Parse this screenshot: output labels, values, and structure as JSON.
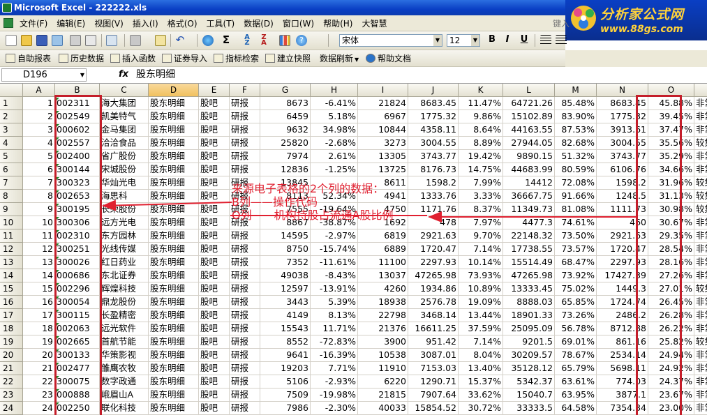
{
  "window": {
    "title": "Microsoft Excel - 222222.xls"
  },
  "brand": {
    "line1": "分析家公式网",
    "line2": "www.88gs.com"
  },
  "menu": {
    "items": [
      "文件(F)",
      "编辑(E)",
      "视图(V)",
      "插入(I)",
      "格式(O)",
      "工具(T)",
      "数据(D)",
      "窗口(W)",
      "帮助(H)",
      "大智慧"
    ],
    "help_box": "键入"
  },
  "toolbar": {
    "font_name": "宋体",
    "font_size": "12",
    "bold": "B",
    "italic": "I",
    "underline": "U"
  },
  "toolbar2": {
    "items": [
      "自助报表",
      "历史数据",
      "插入函数",
      "证券导入",
      "指标检索",
      "建立快照",
      "数据刷新",
      "帮助文档"
    ]
  },
  "formula": {
    "name_box": "D196",
    "fx": "fx",
    "content": "股东明细"
  },
  "columns": [
    "A",
    "B",
    "C",
    "D",
    "E",
    "F",
    "G",
    "H",
    "I",
    "J",
    "K",
    "L",
    "M",
    "N",
    "O",
    ""
  ],
  "rows": [
    {
      "n": "1",
      "a": "1",
      "b": "002311",
      "c": "海大集团",
      "d": "股东明细",
      "e": "股吧",
      "f": "研报",
      "g": "8673",
      "h": "-6.41%",
      "i": "21824",
      "j": "8683.45",
      "k": "11.47%",
      "l": "64721.26",
      "m": "85.48%",
      "nv": "8683.45",
      "o": "45.88%",
      "p": "非常"
    },
    {
      "n": "2",
      "a": "2",
      "b": "002549",
      "c": "凯美特气",
      "d": "股东明细",
      "e": "股吧",
      "f": "研报",
      "g": "6459",
      "h": "5.18%",
      "i": "6967",
      "j": "1775.32",
      "k": "9.86%",
      "l": "15102.89",
      "m": "83.90%",
      "nv": "1775.32",
      "o": "39.45%",
      "p": "非常"
    },
    {
      "n": "3",
      "a": "3",
      "b": "000602",
      "c": "金马集团",
      "d": "股东明细",
      "e": "股吧",
      "f": "研报",
      "g": "9632",
      "h": "34.98%",
      "i": "10844",
      "j": "4358.11",
      "k": "8.64%",
      "l": "44163.55",
      "m": "87.53%",
      "nv": "3913.61",
      "o": "37.47%",
      "p": "非常"
    },
    {
      "n": "4",
      "a": "4",
      "b": "002557",
      "c": "洽洽食品",
      "d": "股东明细",
      "e": "股吧",
      "f": "研报",
      "g": "25820",
      "h": "-2.68%",
      "i": "3273",
      "j": "3004.55",
      "k": "8.89%",
      "l": "27944.05",
      "m": "82.68%",
      "nv": "3004.55",
      "o": "35.56%",
      "p": "较集"
    },
    {
      "n": "5",
      "a": "5",
      "b": "002400",
      "c": "省广股份",
      "d": "股东明细",
      "e": "股吧",
      "f": "研报",
      "g": "7974",
      "h": "2.61%",
      "i": "13305",
      "j": "3743.77",
      "k": "19.42%",
      "l": "9890.15",
      "m": "51.32%",
      "nv": "3743.77",
      "o": "35.29%",
      "p": "非常"
    },
    {
      "n": "6",
      "a": "6",
      "b": "300144",
      "c": "宋城股份",
      "d": "股东明细",
      "e": "股吧",
      "f": "研报",
      "g": "12836",
      "h": "-1.25%",
      "i": "13725",
      "j": "8176.73",
      "k": "14.75%",
      "l": "44683.99",
      "m": "80.59%",
      "nv": "6106.76",
      "o": "34.66%",
      "p": "非常"
    },
    {
      "n": "7",
      "a": "7",
      "b": "300323",
      "c": "华灿光电",
      "d": "股东明细",
      "e": "股吧",
      "f": "研报",
      "g": "13845",
      "h": "",
      "i": "8611",
      "j": "1598.2",
      "k": "7.99%",
      "l": "14412",
      "m": "72.08%",
      "nv": "1598.2",
      "o": "31.96%",
      "p": "较集"
    },
    {
      "n": "8",
      "a": "8",
      "b": "002653",
      "c": "海思科",
      "d": "股东明细",
      "e": "股吧",
      "f": "研报",
      "g": "8113",
      "h": "52.34%",
      "i": "4941",
      "j": "1333.76",
      "k": "3.33%",
      "l": "36667.75",
      "m": "91.66%",
      "nv": "1248.5",
      "o": "31.13%",
      "p": "较集"
    },
    {
      "n": "9",
      "a": "9",
      "b": "300195",
      "c": "长荣股份",
      "d": "股东明细",
      "e": "股吧",
      "f": "研报",
      "g": "7555",
      "h": "-19.64%",
      "i": "4750",
      "j": "1171.76",
      "k": "8.37%",
      "l": "11349.73",
      "m": "81.08%",
      "nv": "1111.73",
      "o": "30.98%",
      "p": "较集"
    },
    {
      "n": "10",
      "a": "10",
      "b": "300306",
      "c": "远方光电",
      "d": "股东明细",
      "e": "股吧",
      "f": "研报",
      "g": "8867",
      "h": "-38.87%",
      "i": "1692",
      "j": "478",
      "k": "7.97%",
      "l": "4477.3",
      "m": "74.61%",
      "nv": "460",
      "o": "30.67%",
      "p": "非常"
    },
    {
      "n": "11",
      "a": "11",
      "b": "002310",
      "c": "东方园林",
      "d": "股东明细",
      "e": "股吧",
      "f": "研报",
      "g": "14595",
      "h": "-2.97%",
      "i": "6819",
      "j": "2921.63",
      "k": "9.70%",
      "l": "22148.32",
      "m": "73.50%",
      "nv": "2921.63",
      "o": "29.35%",
      "p": "非常"
    },
    {
      "n": "12",
      "a": "12",
      "b": "300251",
      "c": "光线传媒",
      "d": "股东明细",
      "e": "股吧",
      "f": "研报",
      "g": "8750",
      "h": "-15.74%",
      "i": "6889",
      "j": "1720.47",
      "k": "7.14%",
      "l": "17738.55",
      "m": "73.57%",
      "nv": "1720.47",
      "o": "28.54%",
      "p": "非常"
    },
    {
      "n": "13",
      "a": "13",
      "b": "300026",
      "c": "红日药业",
      "d": "股东明细",
      "e": "股吧",
      "f": "研报",
      "g": "7352",
      "h": "-11.61%",
      "i": "11100",
      "j": "2297.93",
      "k": "10.14%",
      "l": "15514.49",
      "m": "68.47%",
      "nv": "2297.93",
      "o": "28.16%",
      "p": "非常"
    },
    {
      "n": "14",
      "a": "14",
      "b": "000686",
      "c": "东北证券",
      "d": "股东明细",
      "e": "股吧",
      "f": "研报",
      "g": "49038",
      "h": "-8.43%",
      "i": "13037",
      "j": "47265.98",
      "k": "73.93%",
      "l": "47265.98",
      "m": "73.92%",
      "nv": "17427.39",
      "o": "27.26%",
      "p": "非常"
    },
    {
      "n": "15",
      "a": "15",
      "b": "002296",
      "c": "辉煌科技",
      "d": "股东明细",
      "e": "股吧",
      "f": "研报",
      "g": "12597",
      "h": "-13.91%",
      "i": "4260",
      "j": "1934.86",
      "k": "10.89%",
      "l": "13333.45",
      "m": "75.02%",
      "nv": "1449.3",
      "o": "27.01%",
      "p": "较集"
    },
    {
      "n": "16",
      "a": "16",
      "b": "300054",
      "c": "鼎龙股份",
      "d": "股东明细",
      "e": "股吧",
      "f": "研报",
      "g": "3443",
      "h": "5.39%",
      "i": "18938",
      "j": "2576.78",
      "k": "19.09%",
      "l": "8888.03",
      "m": "65.85%",
      "nv": "1724.74",
      "o": "26.45%",
      "p": "非常"
    },
    {
      "n": "17",
      "a": "17",
      "b": "300115",
      "c": "长盈精密",
      "d": "股东明细",
      "e": "股吧",
      "f": "研报",
      "g": "4149",
      "h": "8.13%",
      "i": "22798",
      "j": "3468.14",
      "k": "13.44%",
      "l": "18901.33",
      "m": "73.26%",
      "nv": "2486.2",
      "o": "26.28%",
      "p": "非常"
    },
    {
      "n": "18",
      "a": "18",
      "b": "002063",
      "c": "远光软件",
      "d": "股东明细",
      "e": "股吧",
      "f": "研报",
      "g": "15543",
      "h": "11.71%",
      "i": "21376",
      "j": "16611.25",
      "k": "37.59%",
      "l": "25095.09",
      "m": "56.78%",
      "nv": "8712.88",
      "o": "26.22%",
      "p": "非常"
    },
    {
      "n": "19",
      "a": "19",
      "b": "002665",
      "c": "首航节能",
      "d": "股东明细",
      "e": "股吧",
      "f": "研报",
      "g": "8552",
      "h": "-72.83%",
      "i": "3900",
      "j": "951.42",
      "k": "7.14%",
      "l": "9201.5",
      "m": "69.01%",
      "nv": "861.16",
      "o": "25.82%",
      "p": "较集"
    },
    {
      "n": "20",
      "a": "20",
      "b": "300133",
      "c": "华策影视",
      "d": "股东明细",
      "e": "股吧",
      "f": "研报",
      "g": "9641",
      "h": "-16.39%",
      "i": "10538",
      "j": "3087.01",
      "k": "8.04%",
      "l": "30209.57",
      "m": "78.67%",
      "nv": "2534.14",
      "o": "24.94%",
      "p": "非常"
    },
    {
      "n": "21",
      "a": "21",
      "b": "002477",
      "c": "雏鹰农牧",
      "d": "股东明细",
      "e": "股吧",
      "f": "研报",
      "g": "19203",
      "h": "7.71%",
      "i": "11910",
      "j": "7153.03",
      "k": "13.40%",
      "l": "35128.12",
      "m": "65.79%",
      "nv": "5698.11",
      "o": "24.92%",
      "p": "非常"
    },
    {
      "n": "22",
      "a": "22",
      "b": "300075",
      "c": "数字政通",
      "d": "股东明细",
      "e": "股吧",
      "f": "研报",
      "g": "5106",
      "h": "-2.93%",
      "i": "6220",
      "j": "1290.71",
      "k": "15.37%",
      "l": "5342.37",
      "m": "63.61%",
      "nv": "774.03",
      "o": "24.37%",
      "p": "非常"
    },
    {
      "n": "23",
      "a": "23",
      "b": "000888",
      "c": "峨眉山A",
      "d": "股东明细",
      "e": "股吧",
      "f": "研报",
      "g": "7509",
      "h": "-19.98%",
      "i": "21815",
      "j": "7907.64",
      "k": "33.62%",
      "l": "15040.7",
      "m": "63.95%",
      "nv": "3877.1",
      "o": "23.67%",
      "p": "非常"
    },
    {
      "n": "24",
      "a": "24",
      "b": "002250",
      "c": "联化科技",
      "d": "股东明细",
      "e": "股吧",
      "f": "研报",
      "g": "7986",
      "h": "-2.30%",
      "i": "40033",
      "j": "15854.52",
      "k": "30.72%",
      "l": "33333.5",
      "m": "64.58%",
      "nv": "7354.34",
      "o": "23.00%",
      "p": "非常"
    }
  ],
  "annotation": {
    "line1": "来源电子表格的2个列的数据：",
    "line2": "B列——操作代码",
    "line3": "O列——机构持股占流通A股比例"
  },
  "colors": {
    "annotation": "#e02030",
    "highlight_box": "#c41e2a",
    "title_bar": "#0a3fc4"
  }
}
